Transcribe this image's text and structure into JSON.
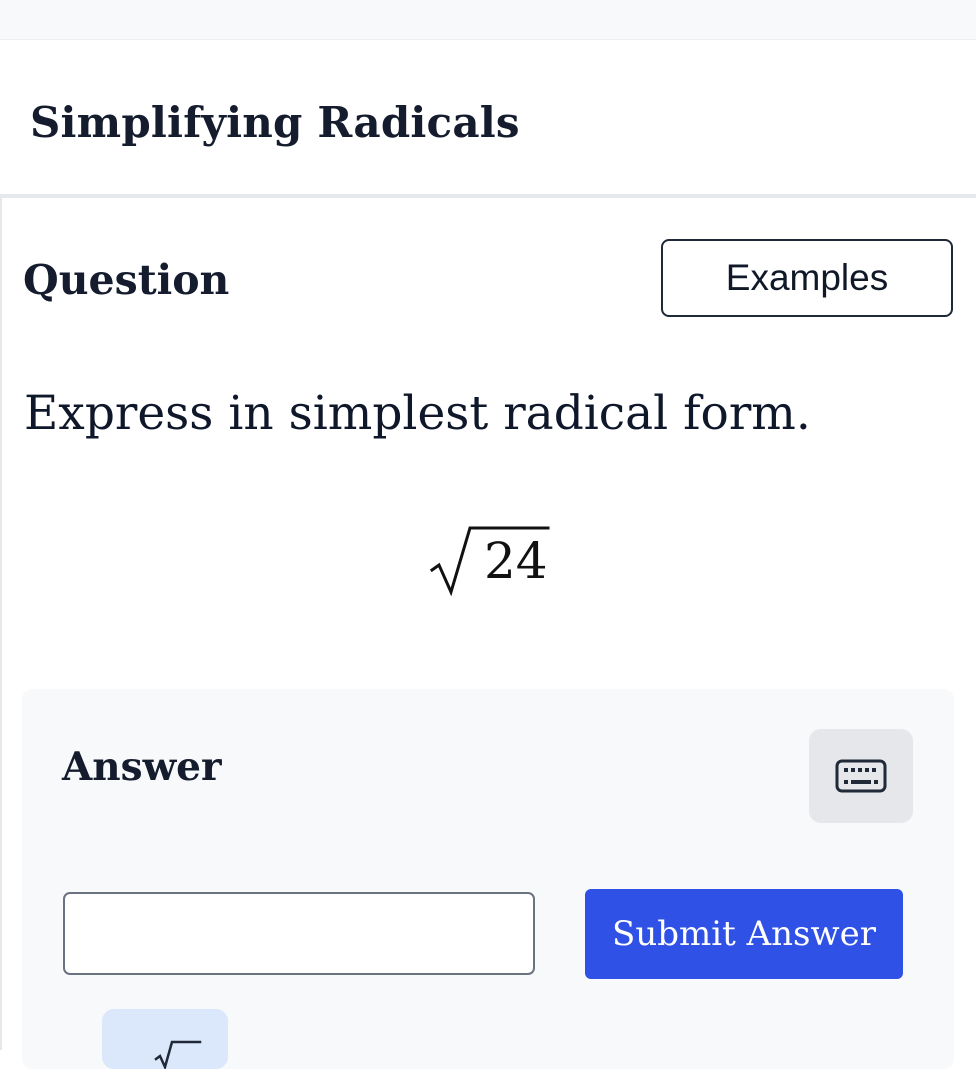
{
  "header": {
    "title": "Simplifying Radicals"
  },
  "question": {
    "heading": "Question",
    "examples_label": "Examples",
    "prompt": "Express in simplest radical form.",
    "expression": {
      "radicand": "24"
    }
  },
  "answer": {
    "heading": "Answer",
    "input_value": "",
    "input_placeholder": "",
    "submit_label": "Submit Answer",
    "keyboard_icon": "keyboard-icon",
    "tool_icon": "square-root-icon"
  },
  "colors": {
    "accent": "#2f51e6",
    "panel": "#f8f9fa",
    "tool_bg": "#dbe7fb",
    "text": "#151c2e"
  }
}
